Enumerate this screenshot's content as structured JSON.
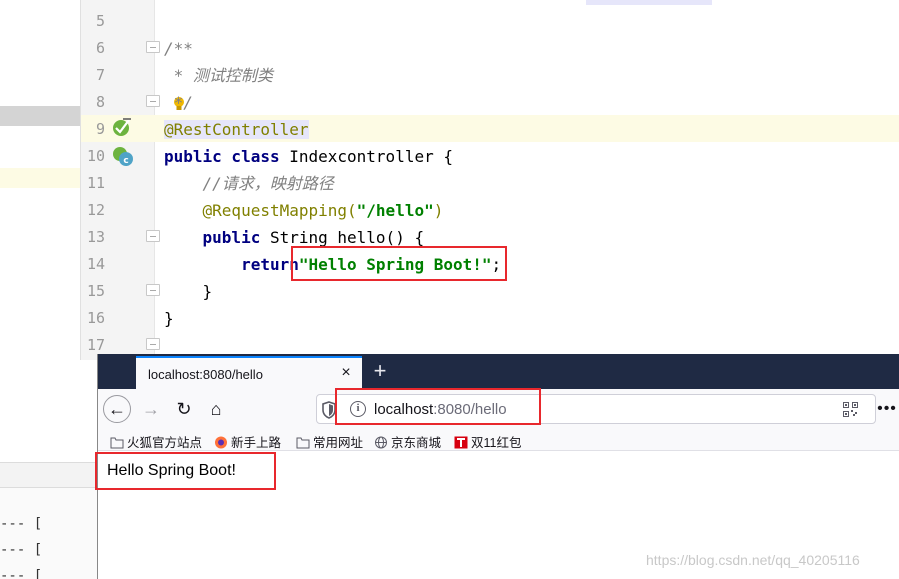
{
  "ide": {
    "line_numbers": [
      "5",
      "6",
      "7",
      "8",
      "9",
      "10",
      "11",
      "12",
      "13",
      "14",
      "15",
      "16",
      "17"
    ],
    "code": {
      "l6": "/**",
      "l7": " * 测试控制类",
      "l8": " */",
      "l9": "@RestController",
      "l10_kw": "public class",
      "l10_name": " Indexcontroller {",
      "l11": "    //请求，映射路径",
      "l12_annot": "    @RequestMapping(",
      "l12_str": "\"/hello\"",
      "l12_close": ")",
      "l13_kw": "    public",
      "l13_rest": " String hello() {",
      "l14_kw": "        return",
      "l14_str": "\"Hello Spring Boot!\"",
      "l14_end": ";",
      "l15": "    }",
      "l16": "}"
    },
    "bottom_lines": [
      "--- [",
      "--- [",
      "--- ["
    ]
  },
  "browser": {
    "tab_title": "localhost:8080/hello",
    "tab_close": "×",
    "new_tab": "+",
    "back": "←",
    "forward": "→",
    "reload": "↻",
    "home": "⌂",
    "url_host": "localhost",
    "url_rest": ":8080/hello",
    "info": "i",
    "more": "•••",
    "bookmarks": [
      "火狐官方站点",
      "新手上路",
      "常用网址",
      "京东商城",
      "双11红包"
    ],
    "page_text": "Hello Spring Boot!"
  },
  "watermark": "https://blog.csdn.net/qq_40205116"
}
